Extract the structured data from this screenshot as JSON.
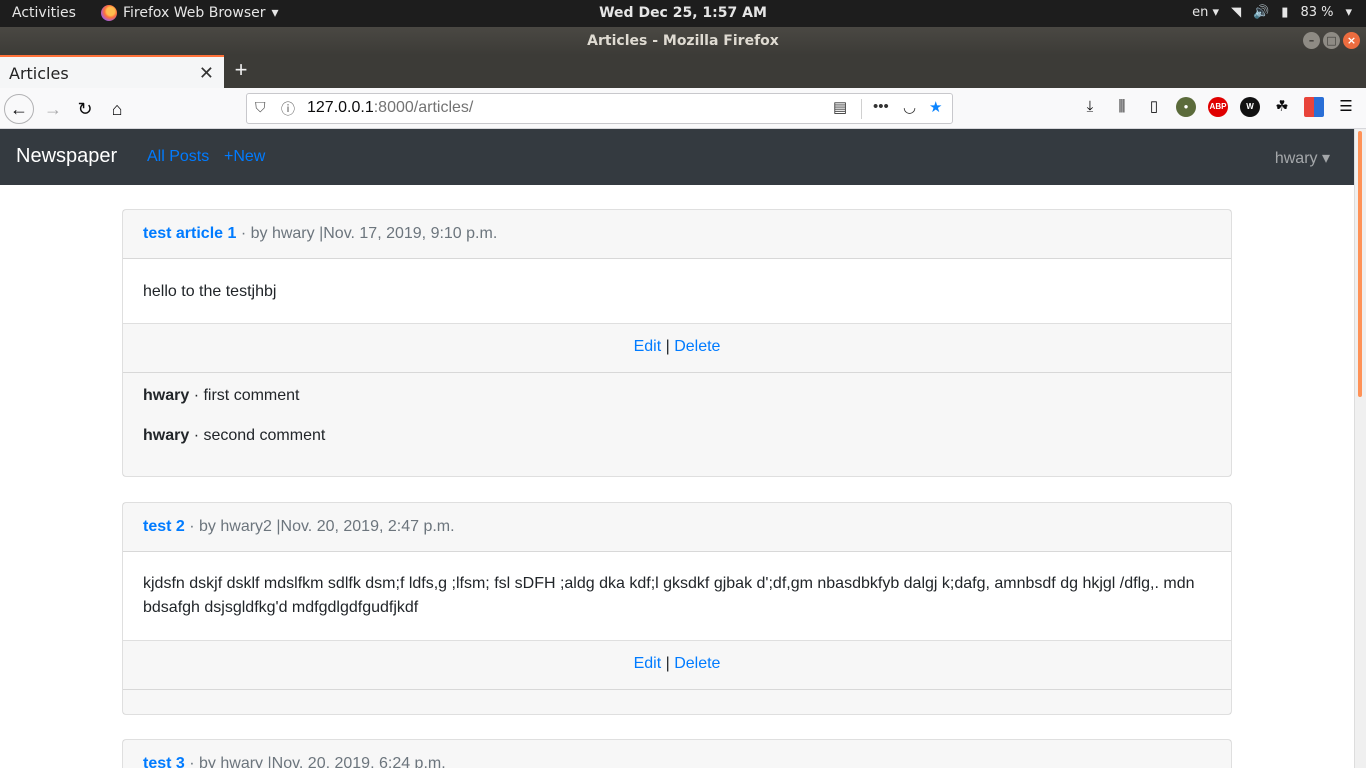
{
  "system": {
    "activities": "Activities",
    "app_name": "Firefox Web Browser",
    "clock": "Wed Dec 25,  1:57 AM",
    "lang": "en",
    "battery": "83 %"
  },
  "window": {
    "title": "Articles - Mozilla Firefox"
  },
  "tab": {
    "title": "Articles"
  },
  "urlbar": {
    "host": "127.0.0.1",
    "rest": ":8000/articles/"
  },
  "site": {
    "brand": "Newspaper",
    "nav": {
      "all_posts": "All Posts",
      "new": "+New"
    },
    "user": "hwary ▾"
  },
  "articles": [
    {
      "title": "test article 1",
      "byline": " · by hwary |Nov. 17, 2019, 9:10 p.m.",
      "body": "hello to the testjhbj",
      "edit": "Edit",
      "sep": " | ",
      "delete": "Delete",
      "comments": [
        {
          "author": "hwary",
          "text": " · first comment"
        },
        {
          "author": "hwary",
          "text": " · second comment"
        }
      ]
    },
    {
      "title": "test 2",
      "byline": " · by hwary2 |Nov. 20, 2019, 2:47 p.m.",
      "body": "kjdsfn dskjf dsklf mdslfkm sdlfk dsm;f ldfs,g ;lfsm; fsl sDFH ;aldg dka kdf;l gksdkf gjbak d';df,gm nbasdbkfyb dalgj k;dafg, amnbsdf dg hkjgl /dflg,. mdn bdsafgh dsjsgldfkg'd mdfgdlgdfgudfjkdf",
      "edit": "Edit",
      "sep": " | ",
      "delete": "Delete",
      "comments": []
    },
    {
      "title": "test 3",
      "byline": " · by hwary |Nov. 20, 2019, 6:24 p.m."
    }
  ]
}
